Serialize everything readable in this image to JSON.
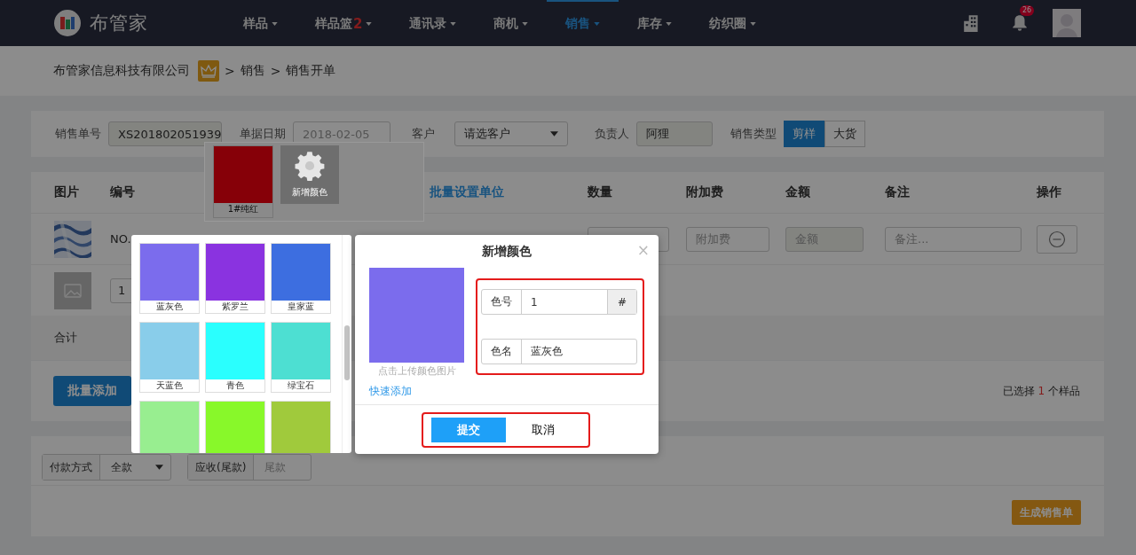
{
  "header": {
    "brand": "布管家",
    "nav": [
      {
        "label": "样品",
        "selected": false
      },
      {
        "label": "样品篮",
        "badge": "2",
        "selected": false
      },
      {
        "label": "通讯录",
        "selected": false
      },
      {
        "label": "商机",
        "selected": false
      },
      {
        "label": "销售",
        "selected": true
      },
      {
        "label": "库存",
        "selected": false
      },
      {
        "label": "纺织圈",
        "selected": false
      }
    ],
    "notifications": "26"
  },
  "breadcrumb": {
    "company": "布管家信息科技有限公司",
    "path": [
      "销售",
      "销售开单"
    ],
    "separator": ">"
  },
  "filters": {
    "order_label": "销售单号",
    "order_value": "XS201802051939",
    "date_label": "单据日期",
    "date_value": "2018-02-05",
    "customer_label": "客户",
    "customer_placeholder": "请选客户",
    "owner_label": "负责人",
    "owner_value": "阿狸",
    "type_label": "销售类型",
    "types": [
      {
        "label": "剪样",
        "selected": true
      },
      {
        "label": "大货",
        "selected": false
      }
    ]
  },
  "table": {
    "columns": [
      {
        "label": "图片",
        "kind": "plain"
      },
      {
        "label": "编号",
        "kind": "plain"
      },
      {
        "label": "批量设置单位",
        "kind": "link"
      },
      {
        "label": "数量",
        "kind": "plain"
      },
      {
        "label": "附加费",
        "kind": "plain"
      },
      {
        "label": "金额",
        "kind": "plain"
      },
      {
        "label": "备注",
        "kind": "plain"
      },
      {
        "label": "操作",
        "kind": "plain"
      }
    ],
    "row_1": {
      "code": "NO.",
      "surcharge_placeholder": "附加费",
      "amount_placeholder": "金额",
      "note_placeholder": "备注..."
    },
    "row_2": {
      "quantity": "1"
    },
    "total_label": "合计"
  },
  "batch": {
    "button": "批量添加",
    "selected": {
      "prefix": "已选择",
      "count": "1",
      "suffix": "个样品"
    }
  },
  "payment": {
    "method_label": "付款方式",
    "method_value": "全款",
    "due_label": "应收(尾款)",
    "due_placeholder": "尾款",
    "submit": "生成销售单"
  },
  "color_popup": {
    "swatches": [
      {
        "label": "1#纯红",
        "color": "#860008"
      }
    ],
    "add_label": "新增颜色"
  },
  "color_grid": [
    {
      "label": "蓝灰色",
      "color": "#7b6ced"
    },
    {
      "label": "紫罗兰",
      "color": "#8a33e0"
    },
    {
      "label": "皇家蓝",
      "color": "#3d6ee0"
    },
    {
      "label": "天蓝色",
      "color": "#89cdea"
    },
    {
      "label": "青色",
      "color": "#2afffe"
    },
    {
      "label": "绿宝石",
      "color": "#4ddfd2"
    },
    {
      "color": "#98ee90"
    },
    {
      "color": "#88f82a"
    },
    {
      "color": "#a0ca3c"
    }
  ],
  "modal": {
    "title": "新增颜色",
    "close": "×",
    "upload_hint": "点击上传颜色图片",
    "quick_add": "快速添加",
    "code_label": "色号",
    "code_value": "1",
    "code_addon": "#",
    "name_label": "色名",
    "name_value": "蓝灰色",
    "submit": "提交",
    "cancel": "取消"
  }
}
